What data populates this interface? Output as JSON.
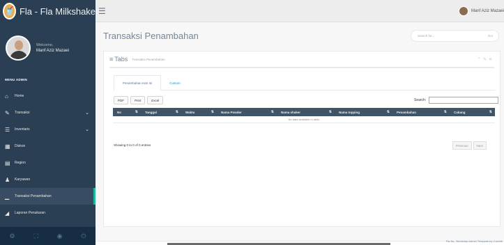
{
  "app": {
    "title": "Fla - Fla Milkshake"
  },
  "profile": {
    "welcome": "Welcome,",
    "name": "Manf Aziz Mazaei"
  },
  "sidebar": {
    "heading": "MENU ADMIN",
    "items": [
      {
        "label": "Home",
        "icon": "home-icon",
        "glyph": "⌂"
      },
      {
        "label": "Transaksi",
        "icon": "edit-icon",
        "glyph": "✎",
        "chevron": "⌄"
      },
      {
        "label": "Inventaris",
        "icon": "list-icon",
        "glyph": "☰",
        "chevron": "⌄"
      },
      {
        "label": "Diskon",
        "icon": "table-icon",
        "glyph": "▦"
      },
      {
        "label": "Region",
        "icon": "file-icon",
        "glyph": "▤"
      },
      {
        "label": "Karyawan",
        "icon": "user-icon",
        "glyph": "♟"
      },
      {
        "label": "Transaksi Penambahan",
        "icon": "chart-icon",
        "glyph": "▁"
      },
      {
        "label": "Laporan Penukaran",
        "icon": "car-icon",
        "glyph": "◢"
      }
    ],
    "footer_icons": [
      "gear-icon",
      "fullscreen-icon",
      "eye-slash-icon",
      "power-icon"
    ]
  },
  "topnav": {
    "user": "Manf Aziz Mazaei"
  },
  "page": {
    "title": "Transaksi Penambahan",
    "search_placeholder": "Search for...",
    "search_button": "Go!"
  },
  "panel": {
    "title": "Tabs",
    "subtitle": "Transaksi Penambahan",
    "tabs": [
      "Penambahan Hari Ini",
      "Custom"
    ],
    "buttons": [
      "PDF",
      "Print",
      "Excel"
    ],
    "search_label": "Search:",
    "columns": [
      "No",
      "Tanggal",
      "Waktu",
      "Nama Powder",
      "Nama shaker",
      "Nama topping",
      "Penambahan",
      "Cabang"
    ],
    "empty_message": "No data available in table",
    "info": "Showing 0 to 0 of 0 entries",
    "pager": [
      "Previous",
      "Next"
    ]
  },
  "footer": {
    "text": "Fla-fla - Bootstrap Admin Template by Colorlib"
  }
}
